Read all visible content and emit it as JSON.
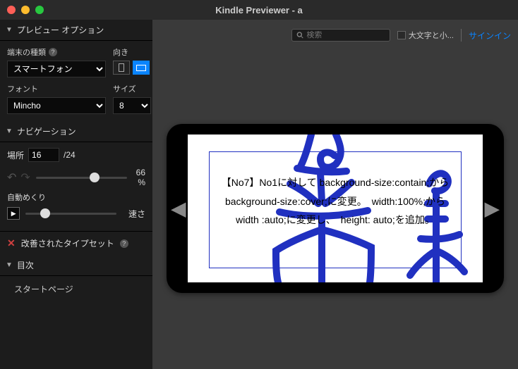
{
  "window": {
    "title": "Kindle Previewer - a"
  },
  "traffic": {
    "close": "#ff5f57",
    "min": "#febc2e",
    "max": "#28c840"
  },
  "sidebar": {
    "preview_options": {
      "title": "プレビュー オプション",
      "device_label": "端末の種類",
      "device_value": "スマートフォン",
      "orientation_label": "向き",
      "font_label": "フォント",
      "font_value": "Mincho",
      "size_label": "サイズ",
      "size_value": "8"
    },
    "navigation": {
      "title": "ナビゲーション",
      "location_label": "場所",
      "location_value": "16",
      "location_total": "/24",
      "zoom_pct": "66 %",
      "auto_label": "自動めくり",
      "speed_label": "速さ"
    },
    "typeset": {
      "label": "改善されたタイプセット"
    },
    "toc": {
      "title": "目次",
      "item": "スタートページ"
    }
  },
  "toolbar": {
    "search_placeholder": "検索",
    "case_label": "大文字と小...",
    "signin": "サインイン"
  },
  "page_content": {
    "line1": "【No7】No1に対して background-size:contain;から",
    "line2": "background-size:cover;に変更。　width:100%;から",
    "line3": "width :auto;に変更し、　height: auto;を追加。"
  }
}
